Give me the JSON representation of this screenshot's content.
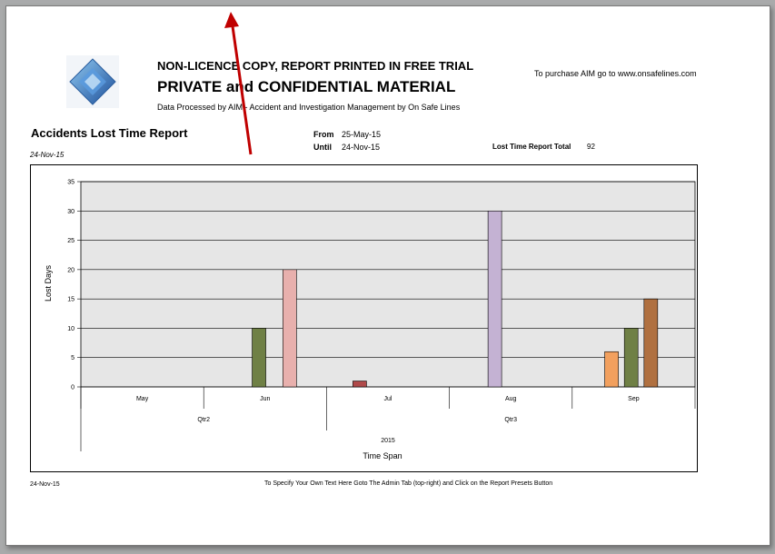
{
  "header": {
    "watermark": "NON-LICENCE COPY, REPORT PRINTED IN FREE TRIAL",
    "main_title": "PRIVATE and CONFIDENTIAL MATERIAL",
    "subtitle": "Data Processed by AIM - Accident and Investigation Management by On Safe Lines",
    "purchase": "To purchase AIM go to www.onsafelines.com"
  },
  "report": {
    "title": "Accidents Lost Time Report",
    "print_date": "24-Nov-15",
    "from_label": "From",
    "from_value": "25-May-15",
    "until_label": "Until",
    "until_value": "24-Nov-15",
    "total_label": "Lost Time Report Total",
    "total_value": "92"
  },
  "footer": {
    "date": "24-Nov-15",
    "note": "To Specify Your Own Text Here Goto The Admin Tab (top-right) and Click on the Report Presets Button"
  },
  "chart_data": {
    "type": "bar",
    "ylabel": "Lost Days",
    "xlabel": "Time Span",
    "ylim": [
      0,
      35
    ],
    "yticks": [
      0,
      5,
      10,
      15,
      20,
      25,
      30,
      35
    ],
    "grid": true,
    "categories": [
      "May",
      "Jun",
      "Jul",
      "Aug",
      "Sep"
    ],
    "quarters": [
      {
        "label": "Qtr2",
        "months": [
          "May",
          "Jun"
        ]
      },
      {
        "label": "Qtr3",
        "months": [
          "Jul",
          "Aug",
          "Sep"
        ]
      }
    ],
    "year": "2015",
    "bars": [
      {
        "month": "Jun",
        "value": 10,
        "color": "#6f8045"
      },
      {
        "month": "Jun",
        "value": 20,
        "color": "#e8b0ad"
      },
      {
        "month": "Jul",
        "value": 1,
        "color": "#b04a4a"
      },
      {
        "month": "Aug",
        "value": 30,
        "color": "#c4b2d3"
      },
      {
        "month": "Sep",
        "value": 6,
        "color": "#f2a05e"
      },
      {
        "month": "Sep",
        "value": 10,
        "color": "#6f8045"
      },
      {
        "month": "Sep",
        "value": 15,
        "color": "#b07040"
      }
    ],
    "plot_bg": "#e6e6e6"
  }
}
